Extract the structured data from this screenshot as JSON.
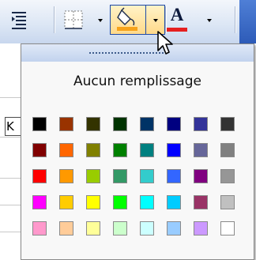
{
  "toolbar": {
    "icons": [
      "align-icon",
      "borders-icon",
      "fill-color-icon",
      "font-color-icon"
    ],
    "font_color_letter": "A",
    "fill_color_current": "#f6a21a",
    "font_color_current": "#e51f1f"
  },
  "sheet": {
    "visible_cell_text": "K"
  },
  "popup": {
    "no_fill_label": "Aucun remplissage",
    "colors": [
      [
        "#000000",
        "#993300",
        "#333300",
        "#003300",
        "#003366",
        "#000080",
        "#333399",
        "#333333"
      ],
      [
        "#800000",
        "#ff6600",
        "#808000",
        "#008000",
        "#008080",
        "#0000ff",
        "#666699",
        "#808080"
      ],
      [
        "#ff0000",
        "#ff9900",
        "#99cc00",
        "#339966",
        "#33cccc",
        "#3366ff",
        "#800080",
        "#969696"
      ],
      [
        "#ff00ff",
        "#ffcc00",
        "#ffff00",
        "#00ff00",
        "#00ffff",
        "#00ccff",
        "#993366",
        "#c0c0c0"
      ],
      [
        "#ff99cc",
        "#ffcc99",
        "#ffff99",
        "#ccffcc",
        "#ccffff",
        "#99ccff",
        "#cc99ff",
        "#ffffff"
      ]
    ]
  }
}
